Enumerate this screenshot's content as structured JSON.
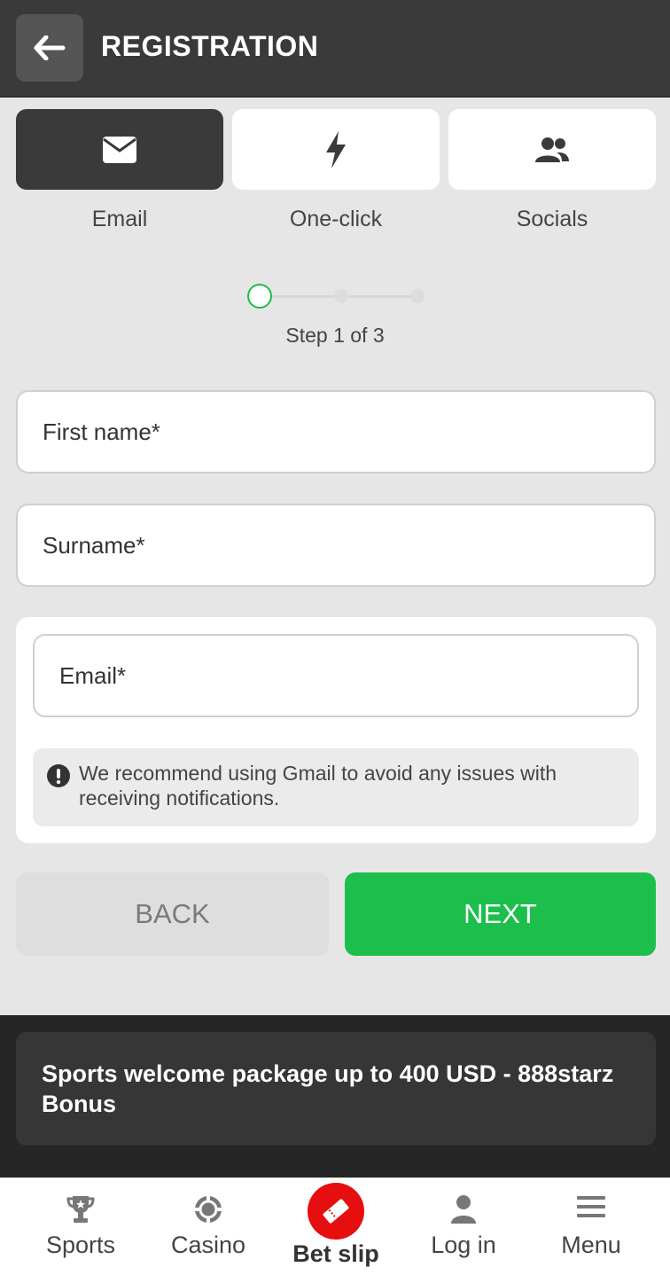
{
  "header": {
    "title": "REGISTRATION"
  },
  "tabs": [
    {
      "label": "Email",
      "icon": "envelope-icon",
      "active": true
    },
    {
      "label": "One-click",
      "icon": "lightning-icon",
      "active": false
    },
    {
      "label": "Socials",
      "icon": "users-icon",
      "active": false
    }
  ],
  "stepper": {
    "text": "Step 1 of 3",
    "current": 1,
    "total": 3
  },
  "form": {
    "first_name_placeholder": "First name*",
    "surname_placeholder": "Surname*",
    "email_placeholder": "Email*",
    "notice": "We recommend using Gmail to avoid any issues with receiving notifications."
  },
  "buttons": {
    "back": "BACK",
    "next": "NEXT"
  },
  "promo": {
    "text": "Sports welcome package up to 400 USD - 888starz Bonus"
  },
  "tabbar": {
    "items": [
      {
        "label": "Sports",
        "icon": "trophy-icon"
      },
      {
        "label": "Casino",
        "icon": "casino-chip-icon"
      },
      {
        "label": "Bet slip",
        "icon": "ticket-icon"
      },
      {
        "label": "Log in",
        "icon": "user-icon"
      },
      {
        "label": "Menu",
        "icon": "hamburger-icon"
      }
    ]
  },
  "colors": {
    "accent_green": "#1cbf4c",
    "header_dark": "#3a3a3a",
    "betslip_red": "#e60e0e"
  }
}
